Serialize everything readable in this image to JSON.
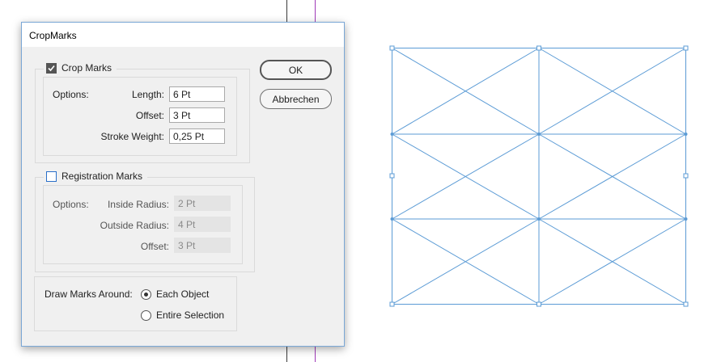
{
  "dialog": {
    "title": "CropMarks",
    "ok_label": "OK",
    "cancel_label": "Abbrechen"
  },
  "crop_marks": {
    "label": "Crop Marks",
    "checked": true,
    "options_label": "Options:",
    "length_label": "Length:",
    "length_value": "6 Pt",
    "offset_label": "Offset:",
    "offset_value": "3 Pt",
    "stroke_label": "Stroke Weight:",
    "stroke_value": "0,25 Pt"
  },
  "registration_marks": {
    "label": "Registration Marks",
    "checked": false,
    "options_label": "Options:",
    "inside_radius_label": "Inside Radius:",
    "inside_radius_value": "2 Pt",
    "outside_radius_label": "Outside Radius:",
    "outside_radius_value": "4 Pt",
    "offset_label": "Offset:",
    "offset_value": "3 Pt"
  },
  "draw_marks": {
    "label": "Draw Marks Around:",
    "options": [
      "Each Object",
      "Entire Selection"
    ],
    "selected": "Each Object"
  },
  "colors": {
    "selection": "#5b9bd5",
    "guide_dark": "#3a3a3a",
    "guide_purple": "#a03ab8",
    "dialog_bg": "#f0f0f0"
  }
}
